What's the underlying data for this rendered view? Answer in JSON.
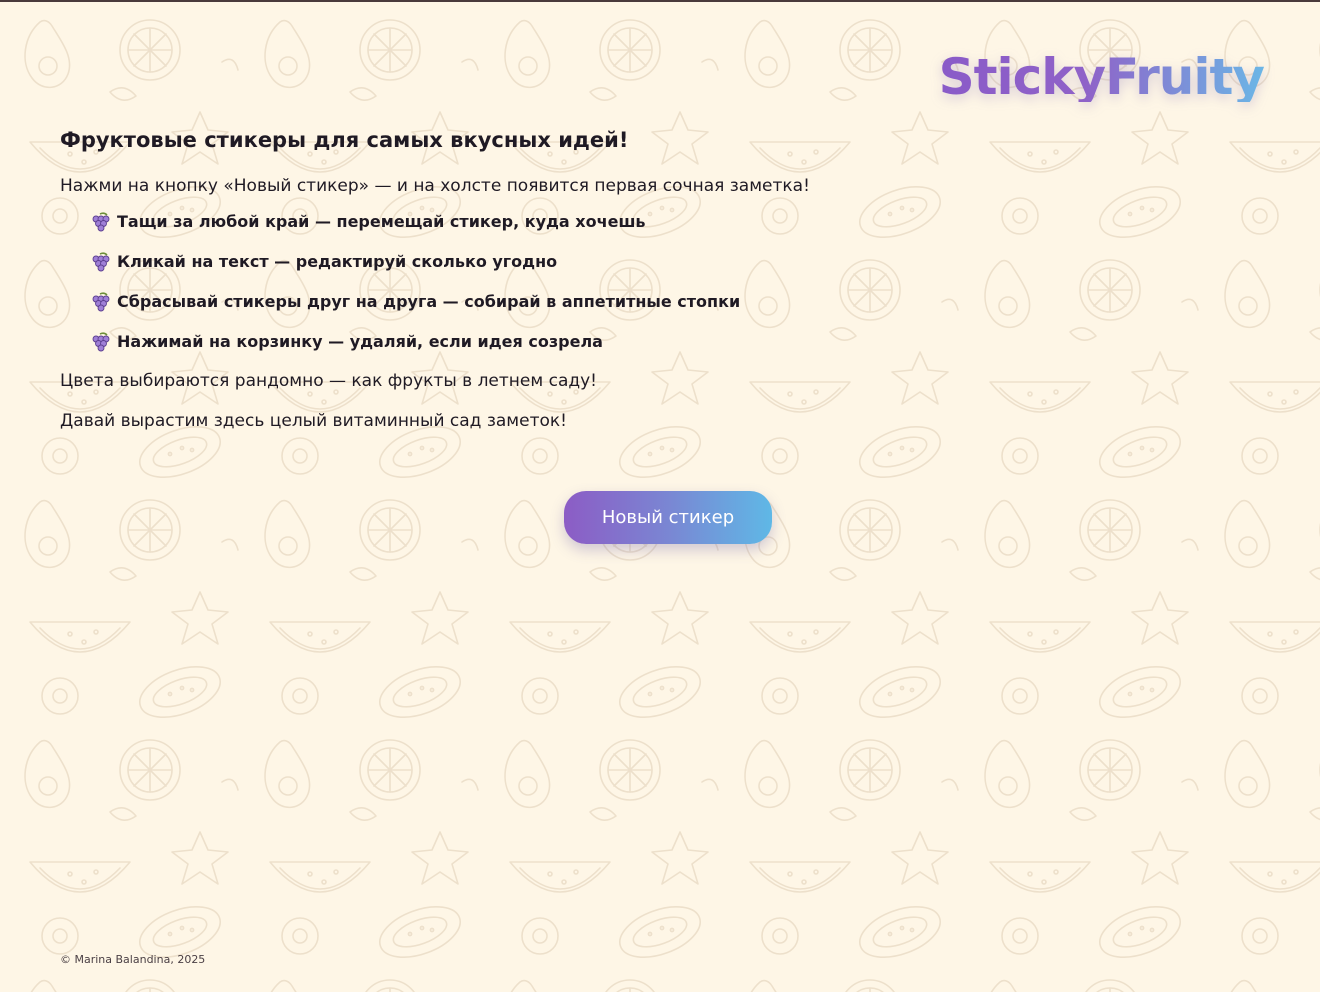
{
  "logo": {
    "text": "StickyFruity"
  },
  "intro": {
    "heading": "Фруктовые стикеры для самых вкусных идей!",
    "instruction": "Нажми на кнопку «Новый стикер» — и на холсте появится первая сочная заметка!",
    "bullet_icon": "grapes-icon",
    "features": [
      "Тащи за любой край — перемещай стикер, куда хочешь",
      "Кликай на текст — редактируй сколько угодно",
      "Сбрасывай стикеры друг на друга — собирай в аппетитные стопки",
      "Нажимай на корзинку — удаляй, если идея созрела"
    ],
    "colors_note": "Цвета выбираются рандомно — как фрукты в летнем саду!",
    "closing": "Давай вырастим здесь целый витаминный сад заметок!"
  },
  "new_sticker_button": {
    "label": "Новый стикер"
  },
  "footer": {
    "copyright": "© Marina Balandina, 2025"
  },
  "theme": {
    "background": "#fef6e6",
    "accent_purple": "#8c5cc5",
    "accent_blue": "#5fb8e6",
    "text": "#1f1a24"
  }
}
